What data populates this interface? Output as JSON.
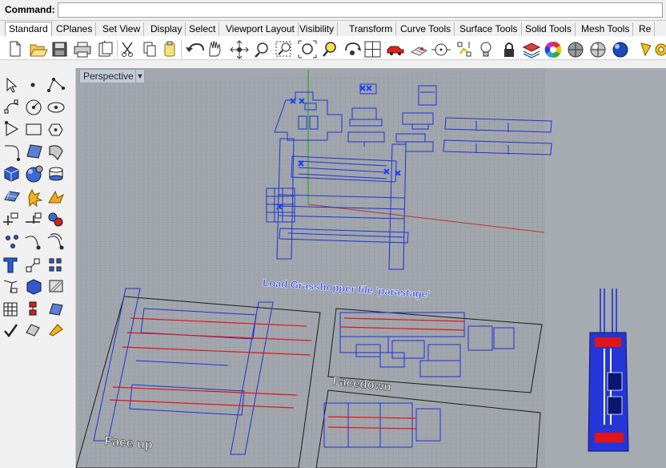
{
  "command": {
    "label": "Command:",
    "value": ""
  },
  "tabs": [
    "Standard",
    "CPlanes",
    "Set View",
    "Display",
    "Select",
    "Viewport Layout",
    "Visibility",
    "Transform",
    "Curve Tools",
    "Surface Tools",
    "Solid Tools",
    "Mesh Tools",
    "Re"
  ],
  "active_tab": "Standard",
  "toolbar_icons": [
    "new-icon",
    "open-icon",
    "save-icon",
    "print-icon",
    "import-icon",
    "cut-icon",
    "copy-icon",
    "paste-icon",
    "undo-icon",
    "pan-icon",
    "rotate-view-icon",
    "zoom-icon",
    "zoom-window-icon",
    "zoom-extents-icon",
    "zoom-selected-icon",
    "rotate-icon",
    "four-viewports-icon",
    "car-icon",
    "grid-icon",
    "osnap-icon",
    "select-points-icon",
    "bulb-icon",
    "lock-icon",
    "layer-icon",
    "color-wheel-icon",
    "shade-icon",
    "render-icon",
    "sphere-icon",
    "draft-icon",
    "options-icon"
  ],
  "sidebar_icons": [
    "select-icon",
    "point-icon",
    "polyline-icon",
    "curve-icon",
    "circle-icon",
    "ellipse-icon",
    "arc-icon",
    "rectangle-icon",
    "polygon-icon",
    "fillet-curve-icon",
    "surface-icon",
    "revolve-icon",
    "box-icon",
    "sphere-solid-icon",
    "cylinder-icon",
    "mesh-plane-icon",
    "explode-icon",
    "burst-icon",
    "split-icon",
    "trim-icon",
    "boolean-icon",
    "points-icon",
    "curve-tools-icon",
    "offset-icon",
    "text-icon",
    "scale-icon",
    "array-icon",
    "dim-icon",
    "shade-box-icon",
    "hatch-icon",
    "grid-array-icon",
    "align-icon",
    "transform-icon",
    "check-icon",
    "block-icon",
    "paint-icon"
  ],
  "viewport": {
    "title": "Perspective",
    "annotations": {
      "load_text": "Load Grasshopper file 'parastage'",
      "face_up": "Face up",
      "facedown": "Facedown"
    },
    "colors": {
      "background": "#a2a6ad",
      "grid": "#8d929a",
      "wire": "#1b34d6",
      "red": "#e41414"
    }
  }
}
